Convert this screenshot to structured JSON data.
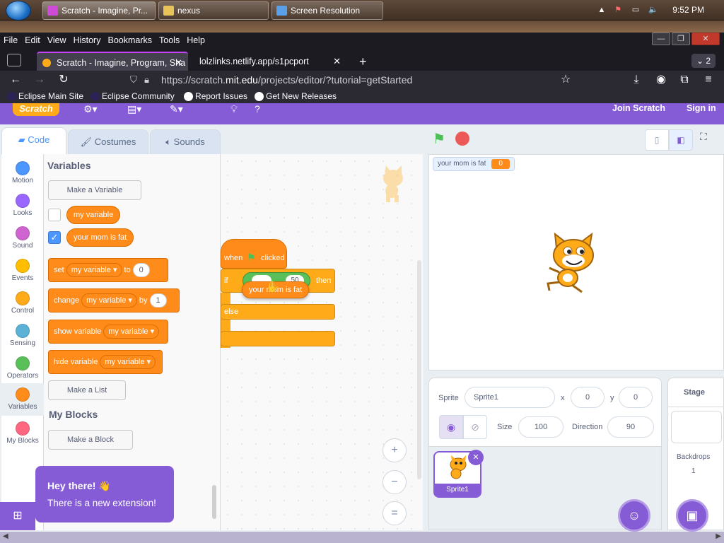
{
  "taskbar": {
    "windows": [
      {
        "label": "Scratch - Imagine, Pr..."
      },
      {
        "label": "nexus"
      },
      {
        "label": "Screen Resolution"
      }
    ],
    "time": "9:52 PM"
  },
  "browser": {
    "menu": [
      "File",
      "Edit",
      "View",
      "History",
      "Bookmarks",
      "Tools",
      "Help"
    ],
    "tabs": [
      {
        "label": "Scratch - Imagine, Program, Sha"
      },
      {
        "label": "lolzlinks.netlify.app/s1pcport"
      }
    ],
    "tab_count": "2",
    "url_prefix": "https://scratch.",
    "url_domain": "mit.edu",
    "url_suffix": "/projects/editor/?tutorial=getStarted",
    "bookmarks": [
      "Eclipse Main Site",
      "Eclipse Community",
      "Report Issues",
      "Get New Releases"
    ]
  },
  "scratch": {
    "logo": "Scratch",
    "join": "Join Scratch",
    "signin": "Sign in",
    "tabs": {
      "code": "Code",
      "costumes": "Costumes",
      "sounds": "Sounds"
    },
    "categories": [
      {
        "label": "Motion",
        "color": "#4c97ff"
      },
      {
        "label": "Looks",
        "color": "#9966ff"
      },
      {
        "label": "Sound",
        "color": "#cf63cf"
      },
      {
        "label": "Events",
        "color": "#ffbf00"
      },
      {
        "label": "Control",
        "color": "#ffab19"
      },
      {
        "label": "Sensing",
        "color": "#5cb1d6"
      },
      {
        "label": "Operators",
        "color": "#59c059"
      },
      {
        "label": "Variables",
        "color": "#ff8c1a"
      },
      {
        "label": "My Blocks",
        "color": "#ff6680"
      }
    ],
    "palette": {
      "variables_title": "Variables",
      "make_variable": "Make a Variable",
      "var1": "my variable",
      "var2": "your mom is fat",
      "set": {
        "a": "set",
        "var": "my variable",
        "b": "to",
        "value": "0"
      },
      "change": {
        "a": "change",
        "var": "my variable",
        "b": "by",
        "value": "1"
      },
      "show": {
        "a": "show variable",
        "var": "my variable"
      },
      "hide": {
        "a": "hide variable",
        "var": "my variable"
      },
      "make_list": "Make a List",
      "myblocks_title": "My Blocks",
      "make_block": "Make a Block"
    },
    "script": {
      "hat_a": "when",
      "hat_b": "clicked",
      "if": "if",
      "then": "then",
      "else": "else",
      "compare_value": "50",
      "reporter": "your mom is fat"
    },
    "monitor": {
      "label": "your mom is fat",
      "value": "0"
    },
    "sprite": {
      "label": "Sprite",
      "name": "Sprite1",
      "x_label": "x",
      "x": "0",
      "y_label": "y",
      "y": "0",
      "size_label": "Size",
      "size": "100",
      "direction_label": "Direction",
      "direction": "90",
      "tile_name": "Sprite1"
    },
    "stage_panel": {
      "title": "Stage",
      "backdrops_label": "Backdrops",
      "backdrops": "1"
    },
    "toast": {
      "title": "Hey there! 👋",
      "body": "There is a new extension!"
    },
    "zoom": {
      "in": "+",
      "out": "−",
      "reset": "="
    }
  },
  "colors": {
    "scratch_purple": "#855cd6",
    "variables_orange": "#ff8c1a",
    "control_orange": "#ffab19",
    "blue": "#4c97ff"
  }
}
